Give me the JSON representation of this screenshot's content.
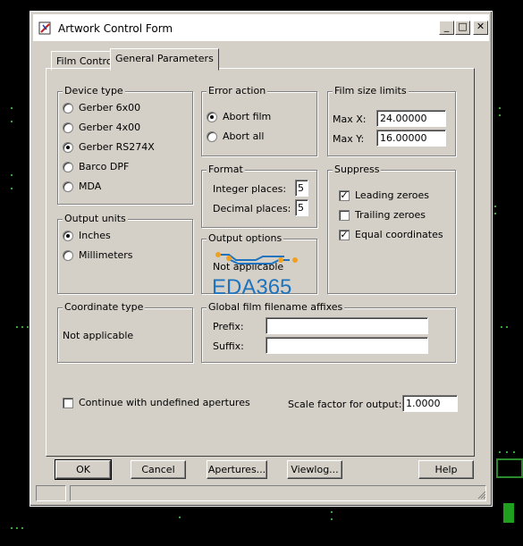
{
  "window": {
    "title": "Artwork Control Form",
    "controls": {
      "minimize": "_",
      "maximize": "□",
      "close": "✕"
    }
  },
  "tabs": [
    {
      "label": "Film Control",
      "active": false
    },
    {
      "label": "General Parameters",
      "active": true
    }
  ],
  "device_type": {
    "label": "Device type",
    "options": [
      "Gerber 6x00",
      "Gerber 4x00",
      "Gerber RS274X",
      "Barco DPF",
      "MDA"
    ],
    "selected": "Gerber RS274X"
  },
  "error_action": {
    "label": "Error action",
    "options": [
      "Abort film",
      "Abort all"
    ],
    "selected": "Abort film"
  },
  "film_size_limits": {
    "label": "Film size limits",
    "max_x_label": "Max X:",
    "max_x_value": "24.00000",
    "max_y_label": "Max Y:",
    "max_y_value": "16.00000"
  },
  "format": {
    "label": "Format",
    "integer_label": "Integer places:",
    "integer_value": "5",
    "decimal_label": "Decimal places:",
    "decimal_value": "5"
  },
  "suppress": {
    "label": "Suppress",
    "options": [
      "Leading zeroes",
      "Trailing zeroes",
      "Equal coordinates"
    ],
    "checked": [
      true,
      false,
      true
    ]
  },
  "output_units": {
    "label": "Output units",
    "options": [
      "Inches",
      "Millimeters"
    ],
    "selected": "Inches"
  },
  "output_options": {
    "label": "Output options",
    "text": "Not applicable"
  },
  "coordinate_type": {
    "label": "Coordinate type",
    "text": "Not applicable"
  },
  "global_affixes": {
    "label": "Global film filename affixes",
    "prefix_label": "Prefix:",
    "prefix_value": "",
    "suffix_label": "Suffix:",
    "suffix_value": ""
  },
  "continue_undefined": {
    "label": "Continue with undefined apertures",
    "checked": false
  },
  "scale": {
    "label": "Scale factor for output:",
    "value": "1.0000"
  },
  "buttons": {
    "ok": "OK",
    "cancel": "Cancel",
    "apertures": "Apertures...",
    "viewlog": "Viewlog...",
    "help": "Help"
  },
  "watermark": {
    "text": "EDA365",
    "color": "#1e73be",
    "accent": "#f0a020"
  },
  "colors": {
    "desktop": "#000000",
    "dialog": "#d4d0c8",
    "grid_dot": "#3aa23a"
  }
}
